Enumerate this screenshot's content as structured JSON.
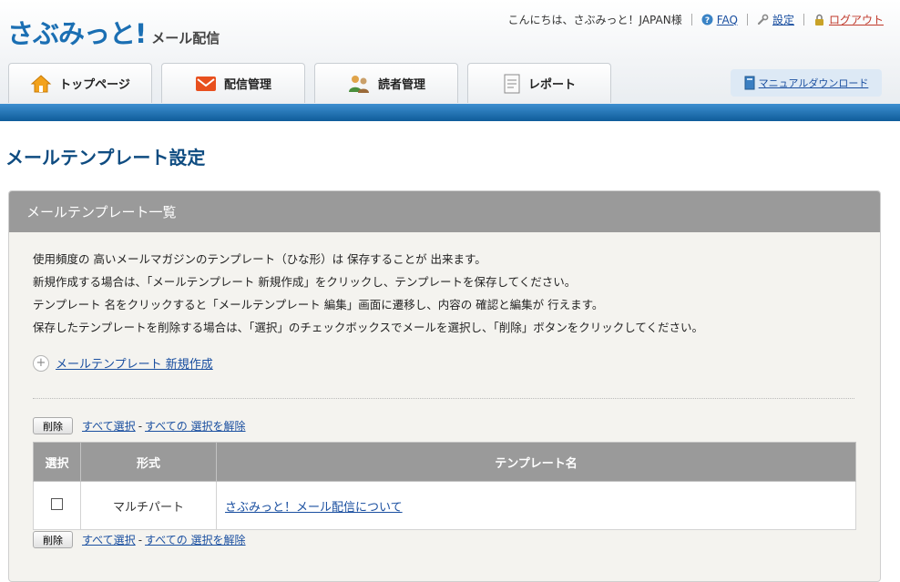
{
  "header": {
    "logo_main": "さぶみっと!",
    "logo_sub": "メール配信",
    "greeting": "こんにちは、さぶみっと！JAPAN様",
    "faq": "FAQ",
    "settings": "設定",
    "logout": "ログアウト",
    "manual_download": "マニュアルダウンロード"
  },
  "tabs": [
    {
      "label": "トップページ",
      "icon": "home-icon"
    },
    {
      "label": "配信管理",
      "icon": "mail-icon"
    },
    {
      "label": "読者管理",
      "icon": "users-icon"
    },
    {
      "label": "レポート",
      "icon": "report-icon"
    }
  ],
  "page_title": "メールテンプレート設定",
  "panel": {
    "title": "メールテンプレート一覧",
    "description": [
      "使用頻度の 高いメールマガジンのテンプレート（ひな形）は 保存することが 出来ます。",
      "新規作成する場合は、「メールテンプレート 新規作成」をクリックし、テンプレートを保存してください。",
      "テンプレート 名をクリックすると「メールテンプレート 編集」画面に遷移し、内容の 確認と編集が 行えます。",
      "保存したテンプレートを削除する場合は、「選択」のチェックボックスでメールを選択し、「削除」ボタンをクリックしてください。"
    ],
    "create_link": "メールテンプレート 新規作成",
    "delete_button": "削除",
    "select_all": "すべて選択",
    "separator": "-",
    "deselect_all": "すべての 選択を解除",
    "columns": [
      "選択",
      "形式",
      "テンプレート名"
    ],
    "rows": [
      {
        "format": "マルチパート",
        "name": "さぶみっと！メール配信について"
      }
    ]
  },
  "colors": {
    "brand_blue": "#1b6fb3",
    "title_blue": "#0f4c81",
    "link_blue": "#1a4fa0",
    "logout_red": "#c0392b",
    "header_bar": "#9a9a9a"
  }
}
